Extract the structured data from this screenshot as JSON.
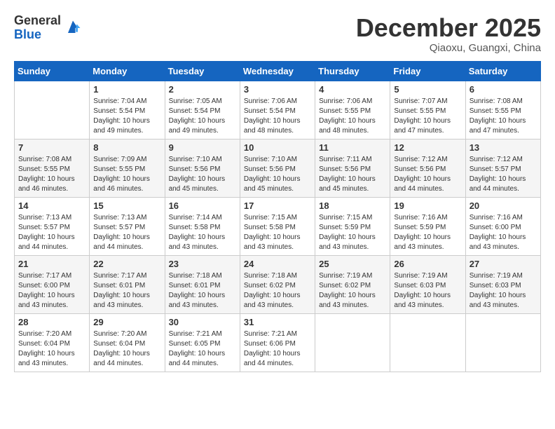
{
  "header": {
    "logo_general": "General",
    "logo_blue": "Blue",
    "month_title": "December 2025",
    "location": "Qiaoxu, Guangxi, China"
  },
  "days_of_week": [
    "Sunday",
    "Monday",
    "Tuesday",
    "Wednesday",
    "Thursday",
    "Friday",
    "Saturday"
  ],
  "weeks": [
    [
      {
        "day": "",
        "empty": true
      },
      {
        "day": "1",
        "sunrise": "7:04 AM",
        "sunset": "5:54 PM",
        "daylight": "10 hours and 49 minutes."
      },
      {
        "day": "2",
        "sunrise": "7:05 AM",
        "sunset": "5:54 PM",
        "daylight": "10 hours and 49 minutes."
      },
      {
        "day": "3",
        "sunrise": "7:06 AM",
        "sunset": "5:54 PM",
        "daylight": "10 hours and 48 minutes."
      },
      {
        "day": "4",
        "sunrise": "7:06 AM",
        "sunset": "5:55 PM",
        "daylight": "10 hours and 48 minutes."
      },
      {
        "day": "5",
        "sunrise": "7:07 AM",
        "sunset": "5:55 PM",
        "daylight": "10 hours and 47 minutes."
      },
      {
        "day": "6",
        "sunrise": "7:08 AM",
        "sunset": "5:55 PM",
        "daylight": "10 hours and 47 minutes."
      }
    ],
    [
      {
        "day": "7",
        "sunrise": "7:08 AM",
        "sunset": "5:55 PM",
        "daylight": "10 hours and 46 minutes."
      },
      {
        "day": "8",
        "sunrise": "7:09 AM",
        "sunset": "5:55 PM",
        "daylight": "10 hours and 46 minutes."
      },
      {
        "day": "9",
        "sunrise": "7:10 AM",
        "sunset": "5:56 PM",
        "daylight": "10 hours and 45 minutes."
      },
      {
        "day": "10",
        "sunrise": "7:10 AM",
        "sunset": "5:56 PM",
        "daylight": "10 hours and 45 minutes."
      },
      {
        "day": "11",
        "sunrise": "7:11 AM",
        "sunset": "5:56 PM",
        "daylight": "10 hours and 45 minutes."
      },
      {
        "day": "12",
        "sunrise": "7:12 AM",
        "sunset": "5:56 PM",
        "daylight": "10 hours and 44 minutes."
      },
      {
        "day": "13",
        "sunrise": "7:12 AM",
        "sunset": "5:57 PM",
        "daylight": "10 hours and 44 minutes."
      }
    ],
    [
      {
        "day": "14",
        "sunrise": "7:13 AM",
        "sunset": "5:57 PM",
        "daylight": "10 hours and 44 minutes."
      },
      {
        "day": "15",
        "sunrise": "7:13 AM",
        "sunset": "5:57 PM",
        "daylight": "10 hours and 44 minutes."
      },
      {
        "day": "16",
        "sunrise": "7:14 AM",
        "sunset": "5:58 PM",
        "daylight": "10 hours and 43 minutes."
      },
      {
        "day": "17",
        "sunrise": "7:15 AM",
        "sunset": "5:58 PM",
        "daylight": "10 hours and 43 minutes."
      },
      {
        "day": "18",
        "sunrise": "7:15 AM",
        "sunset": "5:59 PM",
        "daylight": "10 hours and 43 minutes."
      },
      {
        "day": "19",
        "sunrise": "7:16 AM",
        "sunset": "5:59 PM",
        "daylight": "10 hours and 43 minutes."
      },
      {
        "day": "20",
        "sunrise": "7:16 AM",
        "sunset": "6:00 PM",
        "daylight": "10 hours and 43 minutes."
      }
    ],
    [
      {
        "day": "21",
        "sunrise": "7:17 AM",
        "sunset": "6:00 PM",
        "daylight": "10 hours and 43 minutes."
      },
      {
        "day": "22",
        "sunrise": "7:17 AM",
        "sunset": "6:01 PM",
        "daylight": "10 hours and 43 minutes."
      },
      {
        "day": "23",
        "sunrise": "7:18 AM",
        "sunset": "6:01 PM",
        "daylight": "10 hours and 43 minutes."
      },
      {
        "day": "24",
        "sunrise": "7:18 AM",
        "sunset": "6:02 PM",
        "daylight": "10 hours and 43 minutes."
      },
      {
        "day": "25",
        "sunrise": "7:19 AM",
        "sunset": "6:02 PM",
        "daylight": "10 hours and 43 minutes."
      },
      {
        "day": "26",
        "sunrise": "7:19 AM",
        "sunset": "6:03 PM",
        "daylight": "10 hours and 43 minutes."
      },
      {
        "day": "27",
        "sunrise": "7:19 AM",
        "sunset": "6:03 PM",
        "daylight": "10 hours and 43 minutes."
      }
    ],
    [
      {
        "day": "28",
        "sunrise": "7:20 AM",
        "sunset": "6:04 PM",
        "daylight": "10 hours and 43 minutes."
      },
      {
        "day": "29",
        "sunrise": "7:20 AM",
        "sunset": "6:04 PM",
        "daylight": "10 hours and 44 minutes."
      },
      {
        "day": "30",
        "sunrise": "7:21 AM",
        "sunset": "6:05 PM",
        "daylight": "10 hours and 44 minutes."
      },
      {
        "day": "31",
        "sunrise": "7:21 AM",
        "sunset": "6:06 PM",
        "daylight": "10 hours and 44 minutes."
      },
      {
        "day": "",
        "empty": true
      },
      {
        "day": "",
        "empty": true
      },
      {
        "day": "",
        "empty": true
      }
    ]
  ]
}
